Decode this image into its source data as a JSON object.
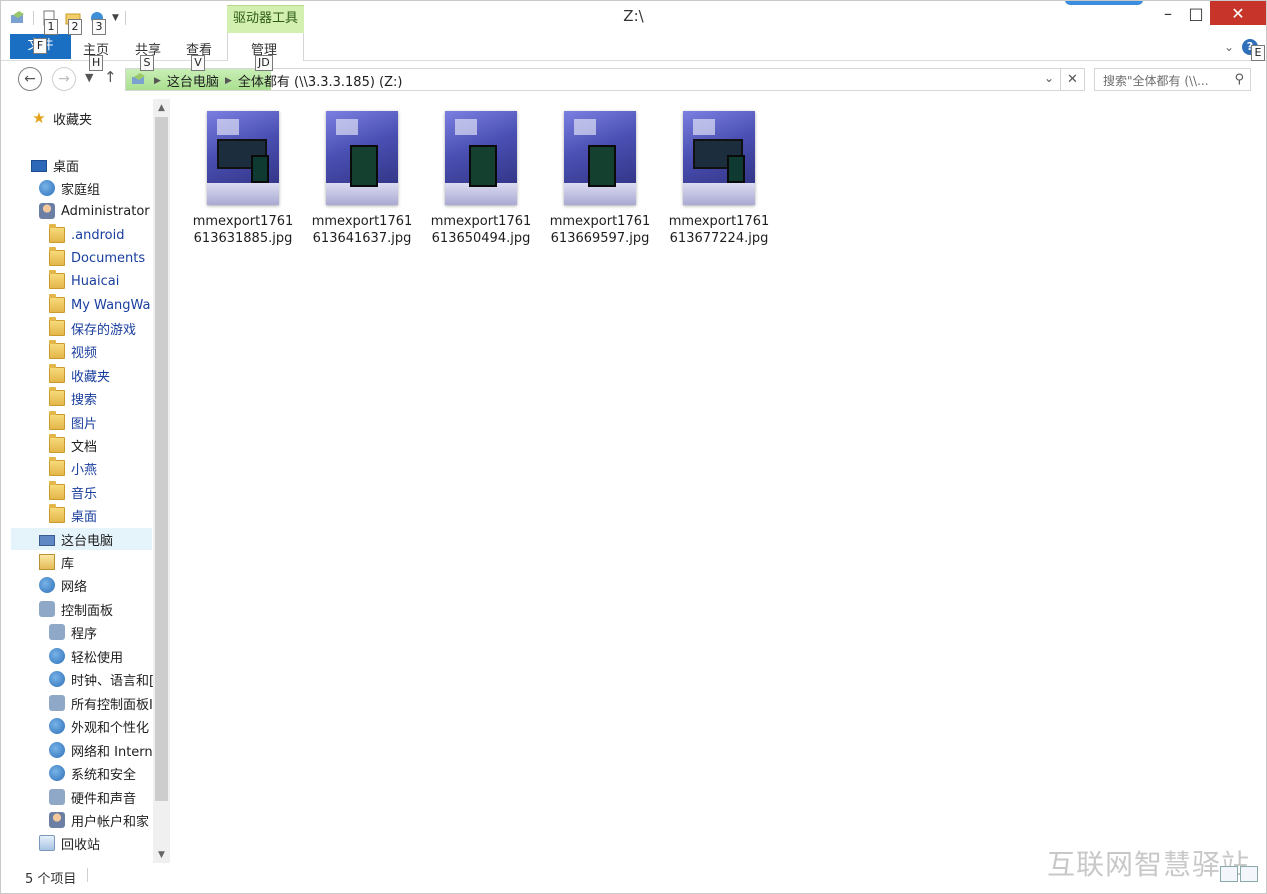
{
  "window": {
    "title": "Z:\\"
  },
  "quick_access": {
    "keytips": [
      "1",
      "2",
      "3"
    ]
  },
  "ribbon": {
    "context_group": "驱动器工具",
    "file_tab": "文件",
    "file_keytip": "F",
    "tabs": [
      {
        "label": "主页",
        "keytip": "H"
      },
      {
        "label": "共享",
        "keytip": "S"
      },
      {
        "label": "查看",
        "keytip": "V"
      },
      {
        "label": "管理",
        "keytip": "JD"
      }
    ],
    "help_keytip": "E"
  },
  "address": {
    "crumbs": [
      "这台电脑",
      "全体都有 (\\\\3.3.3.185) (Z:)"
    ],
    "search_placeholder": "搜索\"全体都有 (\\\\..."
  },
  "nav_tree": [
    {
      "label": "收藏夹",
      "icon": "star-icon"
    },
    {
      "label": "桌面",
      "icon": "desktop-icon"
    },
    {
      "label": "家庭组",
      "icon": "homegroup-icon"
    },
    {
      "label": "Administrator",
      "icon": "user-icon"
    },
    {
      "label": ".android",
      "icon": "folder-icon"
    },
    {
      "label": "Documents",
      "icon": "folder-icon"
    },
    {
      "label": "Huaicai",
      "icon": "folder-icon"
    },
    {
      "label": "My WangWa",
      "icon": "folder-icon"
    },
    {
      "label": "保存的游戏",
      "icon": "folder-icon"
    },
    {
      "label": "视频",
      "icon": "folder-icon"
    },
    {
      "label": "收藏夹",
      "icon": "folder-icon"
    },
    {
      "label": "搜索",
      "icon": "folder-icon"
    },
    {
      "label": "图片",
      "icon": "folder-icon"
    },
    {
      "label": "文档",
      "icon": "folder-icon"
    },
    {
      "label": "小燕",
      "icon": "folder-icon"
    },
    {
      "label": "音乐",
      "icon": "folder-icon"
    },
    {
      "label": "桌面",
      "icon": "folder-icon"
    },
    {
      "label": "这台电脑",
      "icon": "computer-icon"
    },
    {
      "label": "库",
      "icon": "library-icon"
    },
    {
      "label": "网络",
      "icon": "network-icon"
    },
    {
      "label": "控制面板",
      "icon": "control-panel-icon"
    },
    {
      "label": "程序",
      "icon": "programs-icon"
    },
    {
      "label": "轻松使用",
      "icon": "ease-of-access-icon"
    },
    {
      "label": "时钟、语言和[",
      "icon": "clock-language-icon"
    },
    {
      "label": "所有控制面板I",
      "icon": "all-control-panel-icon"
    },
    {
      "label": "外观和个性化",
      "icon": "appearance-icon"
    },
    {
      "label": "网络和 Interne",
      "icon": "network-internet-icon"
    },
    {
      "label": "系统和安全",
      "icon": "system-security-icon"
    },
    {
      "label": "硬件和声音",
      "icon": "hardware-sound-icon"
    },
    {
      "label": "用户帐户和家",
      "icon": "user-accounts-icon"
    },
    {
      "label": "回收站",
      "icon": "recycle-bin-icon"
    }
  ],
  "files": [
    {
      "line1": "mmexport1761",
      "line2": "613631885.jpg"
    },
    {
      "line1": "mmexport1761",
      "line2": "613641637.jpg"
    },
    {
      "line1": "mmexport1761",
      "line2": "613650494.jpg"
    },
    {
      "line1": "mmexport1761",
      "line2": "613669597.jpg"
    },
    {
      "line1": "mmexport1761",
      "line2": "613677224.jpg"
    }
  ],
  "status": {
    "item_count": "5 个项目"
  },
  "watermark": "互联网智慧驿站",
  "colors": {
    "accent": "#1a6fc2",
    "context_tab": "#d3f0b0",
    "close": "#c7352a",
    "link": "#1a3e9e"
  }
}
